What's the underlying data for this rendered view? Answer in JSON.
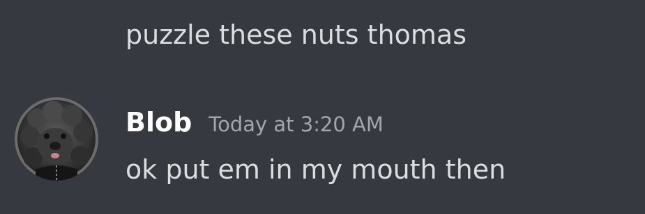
{
  "messages": {
    "continued": {
      "text": "puzzle these nuts thomas"
    },
    "group": {
      "avatar_icon": "dog-avatar-icon",
      "username": "Blob",
      "timestamp": "Today at 3:20 AM",
      "text": "ok put em in my mouth then"
    }
  },
  "colors": {
    "background": "#36393f",
    "message_text": "#dcddde",
    "username": "#ffffff",
    "timestamp": "#a3a6aa"
  }
}
